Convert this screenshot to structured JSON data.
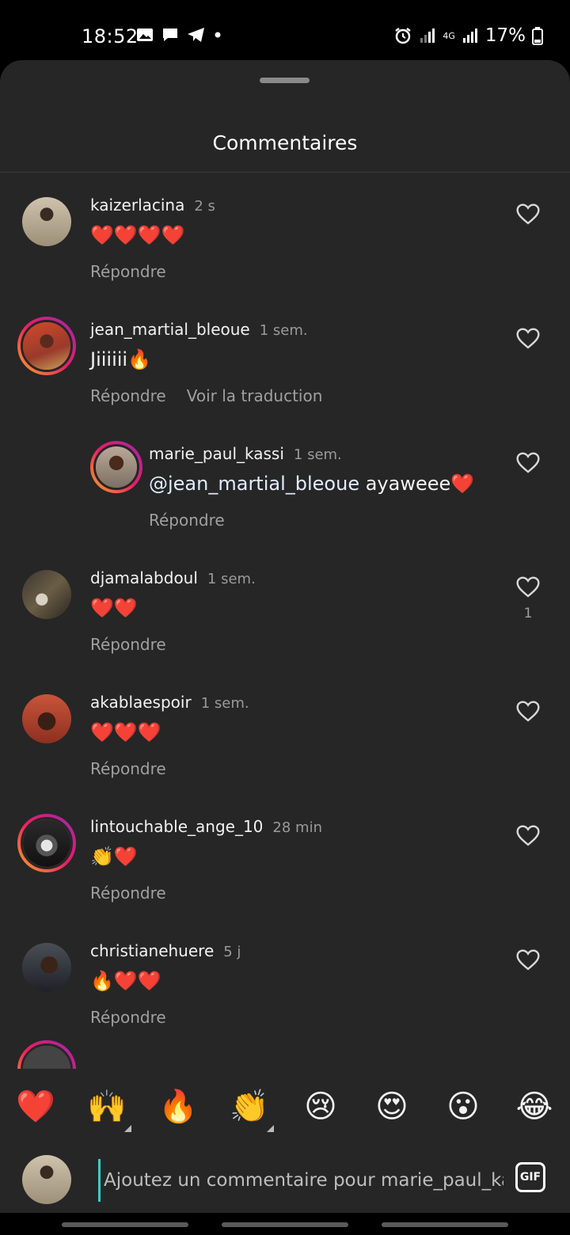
{
  "status": {
    "time": "18:52",
    "battery": "17%",
    "network": "4G"
  },
  "sheet": {
    "title": "Commentaires"
  },
  "comments": [
    {
      "user": "kaizerlacina",
      "time": "2 s",
      "text": "❤️❤️❤️❤️",
      "reply": "Répondre",
      "translate": "",
      "likes": ""
    },
    {
      "user": "jean_martial_bleoue",
      "time": "1 sem.",
      "text": "Jiiiiii🔥",
      "reply": "Répondre",
      "translate": "Voir la traduction",
      "likes": ""
    },
    {
      "user": "marie_paul_kassi",
      "time": "1 sem.",
      "mention": "@jean_martial_bleoue",
      "text": " ayaweee❤️",
      "reply": "Répondre",
      "translate": "",
      "likes": ""
    },
    {
      "user": "djamalabdoul",
      "time": "1 sem.",
      "text": "❤️❤️",
      "reply": "Répondre",
      "translate": "",
      "likes": "1"
    },
    {
      "user": "akablaespoir",
      "time": "1 sem.",
      "text": "❤️❤️❤️",
      "reply": "Répondre",
      "translate": "",
      "likes": ""
    },
    {
      "user": "lintouchable_ange_10",
      "time": "28 min",
      "text": "👏❤️",
      "reply": "Répondre",
      "translate": "",
      "likes": ""
    },
    {
      "user": "christianehuere",
      "time": "5 j",
      "text": "🔥❤️❤️",
      "reply": "Répondre",
      "translate": "",
      "likes": ""
    }
  ],
  "emoji_bar": [
    "❤️",
    "🙌",
    "🔥",
    "👏",
    "😢",
    "😍",
    "😮",
    "😂"
  ],
  "composer": {
    "placeholder": "Ajoutez un commentaire pour marie_paul_kassi...",
    "gif_label": "GIF"
  },
  "colors": {
    "background": "#262626",
    "accent_cursor": "#37d0c4",
    "story_ring": "#e91e63"
  }
}
